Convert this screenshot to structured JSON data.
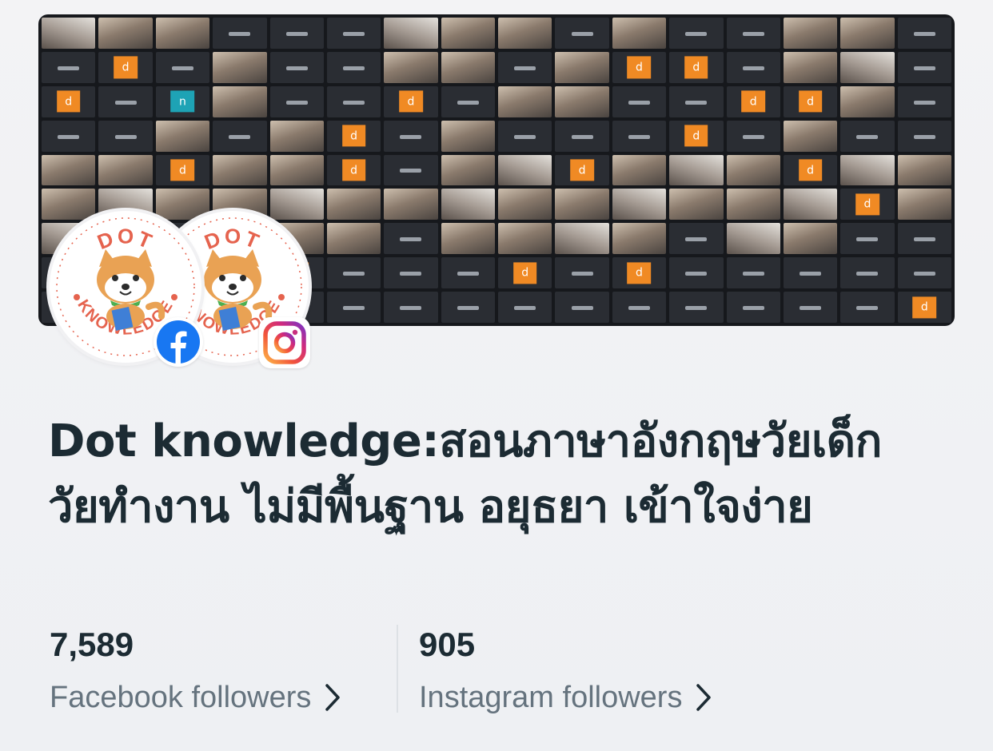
{
  "profile": {
    "title": "Dot knowledge:สอนภาษาอังกฤษวัยเด็ก วัยทำงาน ไม่มีพื้นฐาน อยุธยา เข้าใจง่าย",
    "logo_text_top": "DOT",
    "logo_text_bottom": "KNOWLEDGE"
  },
  "stats": {
    "facebook": {
      "count": "7,589",
      "label": "Facebook followers",
      "icon": "chevron-right-icon"
    },
    "instagram": {
      "count": "905",
      "label": "Instagram followers",
      "icon": "chevron-right-icon"
    }
  },
  "colors": {
    "title": "#1c2b33",
    "secondary_text": "#65737e",
    "facebook_blue": "#1877f2",
    "logo_red": "#e5634e",
    "tile_orange": "#f08a24"
  },
  "icons": {
    "cover": "video-call-grid-image",
    "fb_badge": "facebook-icon",
    "ig_badge": "instagram-icon"
  }
}
